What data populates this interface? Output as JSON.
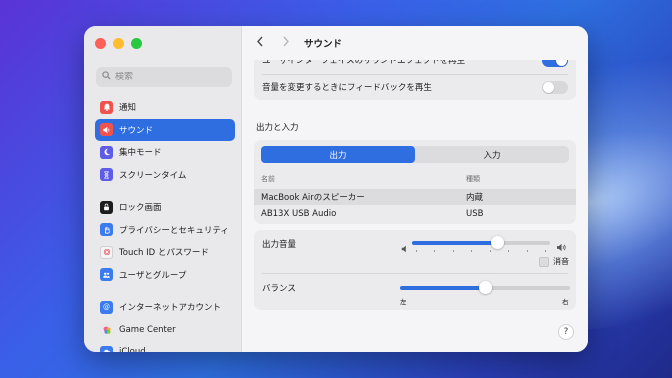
{
  "window": {
    "title": "サウンド"
  },
  "colors": {
    "accent": "#2f6ee0",
    "background": "#f5f5f7",
    "sidebar": "#e9e8ea"
  },
  "search": {
    "placeholder": "検索",
    "icon": "search-icon"
  },
  "sidebar": {
    "items": [
      {
        "label": "通知",
        "icon": "bell-icon",
        "icon_color": "#f0524e",
        "selected": false
      },
      {
        "label": "サウンド",
        "icon": "speaker-icon",
        "icon_color": "#f0524e",
        "selected": true
      },
      {
        "label": "集中モード",
        "icon": "moon-icon",
        "icon_color": "#5e5ce6",
        "selected": false
      },
      {
        "label": "スクリーンタイム",
        "icon": "hourglass-icon",
        "icon_color": "#5e5ce6",
        "selected": false
      },
      {
        "label": "ロック画面",
        "icon": "lock-screen-icon",
        "icon_color": "#1d1d1f",
        "selected": false
      },
      {
        "label": "プライバシーとセキュリティ",
        "icon": "hand-icon",
        "icon_color": "#3a7bf0",
        "selected": false
      },
      {
        "label": "Touch ID とパスワード",
        "icon": "fingerprint-icon",
        "icon_color": "#f4f4f4",
        "selected": false
      },
      {
        "label": "ユーザとグループ",
        "icon": "users-icon",
        "icon_color": "#3a7bf0",
        "selected": false
      },
      {
        "label": "インターネットアカウント",
        "icon": "at-icon",
        "icon_color": "#3a7bf0",
        "selected": false
      },
      {
        "label": "Game Center",
        "icon": "game-center-icon",
        "icon_color": "#e8e8e8",
        "selected": false
      },
      {
        "label": "iCloud",
        "icon": "cloud-icon",
        "icon_color": "#3a7bf0",
        "selected": false
      }
    ]
  },
  "effects": {
    "partial_row_label": "ユーザインターフェイスのサウンドエフェクトを再生",
    "partial_row_on": true,
    "feedback_label": "音量を変更するときにフィードバックを再生",
    "feedback_on": false
  },
  "io": {
    "section_title": "出力と入力",
    "tabs": [
      {
        "label": "出力",
        "active": true
      },
      {
        "label": "入力",
        "active": false
      }
    ],
    "columns": {
      "name": "名前",
      "type": "種類"
    },
    "devices": [
      {
        "name": "MacBook Airのスピーカー",
        "type": "内蔵",
        "selected": true
      },
      {
        "name": "AB13X USB Audio",
        "type": "USB",
        "selected": false
      }
    ]
  },
  "output_volume": {
    "label": "出力音量",
    "value": 0.62,
    "mute_label": "消音",
    "muted": false
  },
  "balance": {
    "label": "バランス",
    "value": 0.5,
    "left_label": "左",
    "right_label": "右"
  },
  "help": {
    "label": "?"
  }
}
